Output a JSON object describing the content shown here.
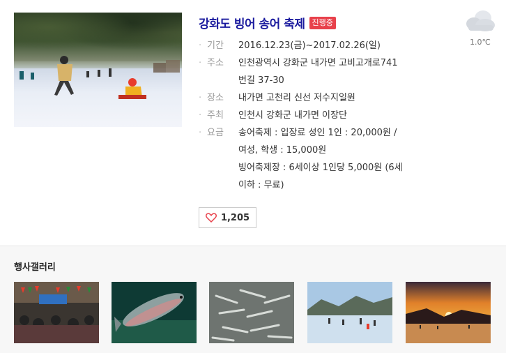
{
  "event": {
    "title": "강화도 빙어 송어 축제",
    "status_badge": "진행중"
  },
  "weather": {
    "icon": "cloud-icon",
    "temperature": "1.0℃"
  },
  "info": [
    {
      "label": "기간",
      "lines": [
        "2016.12.23(금)~2017.02.26(일)"
      ]
    },
    {
      "label": "주소",
      "lines": [
        "인천광역시 강화군 내가면 고비고개로741",
        "번길 37-30"
      ]
    },
    {
      "label": "장소",
      "lines": [
        "내가면 고천리 신선 저수지일원"
      ]
    },
    {
      "label": "주최",
      "lines": [
        "인천시 강화군 내가면 이장단"
      ]
    },
    {
      "label": "요금",
      "lines": [
        "송어축제 : 입장료 성인 1인 : 20,000원 /",
        "여성, 학생 : 15,000원",
        "빙어축제장 : 6세이상 1인당 5,000원 (6세",
        "이하 : 무료)"
      ]
    }
  ],
  "like": {
    "icon": "heart-icon",
    "count": "1,205"
  },
  "gallery": {
    "title": "행사갤러리"
  },
  "colors": {
    "title": "#1a1a9e",
    "badge": "#e8414b",
    "heart": "#e8414b"
  }
}
